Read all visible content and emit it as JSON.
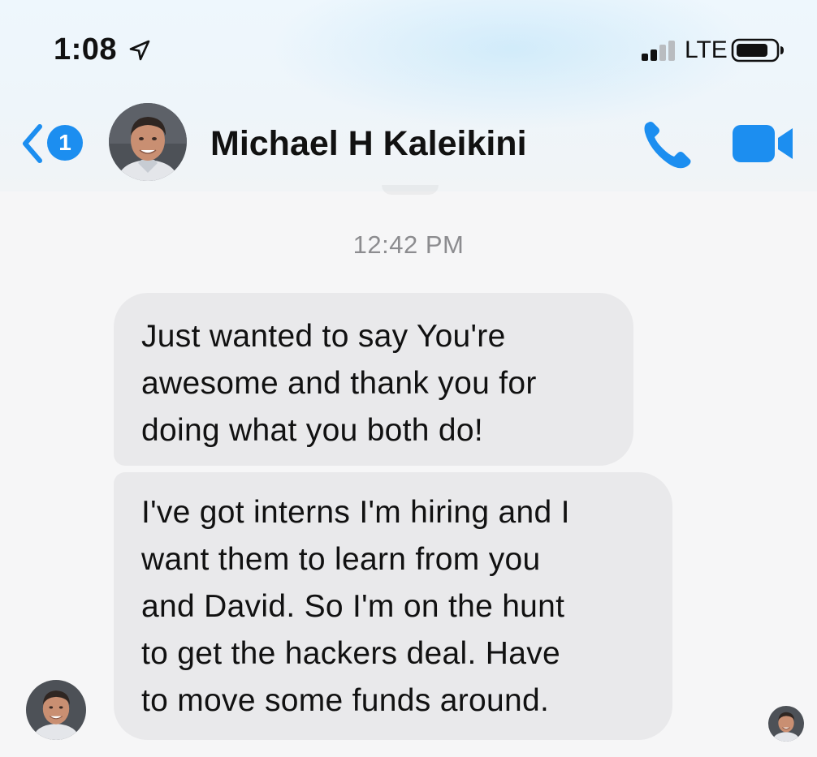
{
  "status_bar": {
    "time": "1:08",
    "network": "LTE",
    "icons": [
      "location-arrow-icon",
      "cellular-signal-icon",
      "battery-icon"
    ]
  },
  "header": {
    "back_badge_count": "1",
    "contact_name": "Michael H Kaleikini",
    "icons": [
      "back-chevron-icon",
      "phone-icon",
      "video-camera-icon"
    ],
    "accent_color": "#1c8ef0"
  },
  "conversation": {
    "timestamp": "12:42 PM",
    "messages": [
      {
        "lines": [
          "Just wanted to say You're",
          "awesome and thank you for",
          "doing what you both do!"
        ]
      },
      {
        "lines": [
          "I've got interns I'm hiring and I",
          "want them to learn from you",
          "and David. So I'm on the hunt",
          "to get the hackers deal. Have",
          "to move some funds around."
        ]
      }
    ],
    "bubble_color": "#e9e9eb"
  }
}
